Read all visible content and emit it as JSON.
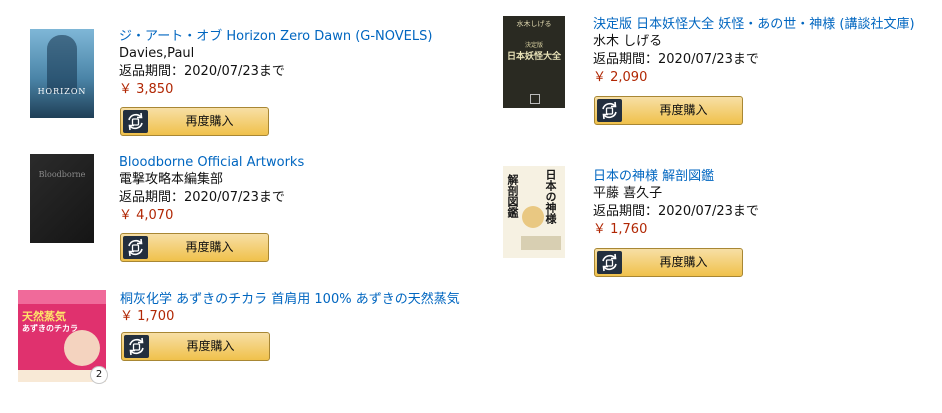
{
  "reorder_label": "再度購入",
  "items": [
    {
      "title": "ジ・アート・オブ Horizon Zero Dawn (G-NOVELS)",
      "author": "Davies,Paul",
      "return_period": "返品期間：2020/07/23まで",
      "price": "￥ 3,850",
      "cover_text": "HORIZON"
    },
    {
      "title": "決定版 日本妖怪大全 妖怪・あの世・神様 (講談社文庫)",
      "author": "水木 しげる",
      "return_period": "返品期間：2020/07/23まで",
      "price": "￥ 2,090",
      "cover_top": "水木しげる",
      "cover_kicker": "決定版",
      "cover_title": "日本妖怪大全"
    },
    {
      "title": "Bloodborne Official Artworks",
      "author": "電撃攻略本編集部",
      "return_period": "返品期間：2020/07/23まで",
      "price": "￥ 4,070",
      "cover_text": "Bloodborne"
    },
    {
      "title": "日本の神様 解剖図鑑",
      "author": "平藤 喜久子",
      "return_period": "返品期間：2020/07/23まで",
      "price": "￥ 1,760",
      "cover_main": "日本の神様",
      "cover_side": "解剖図鑑"
    },
    {
      "title": "桐灰化学 あずきのチカラ 首肩用 100% あずきの天然蒸気",
      "price": "￥ 1,700",
      "cover_line1": "天然蒸気",
      "cover_line2": "あずきのチカラ",
      "badge": "2"
    }
  ]
}
